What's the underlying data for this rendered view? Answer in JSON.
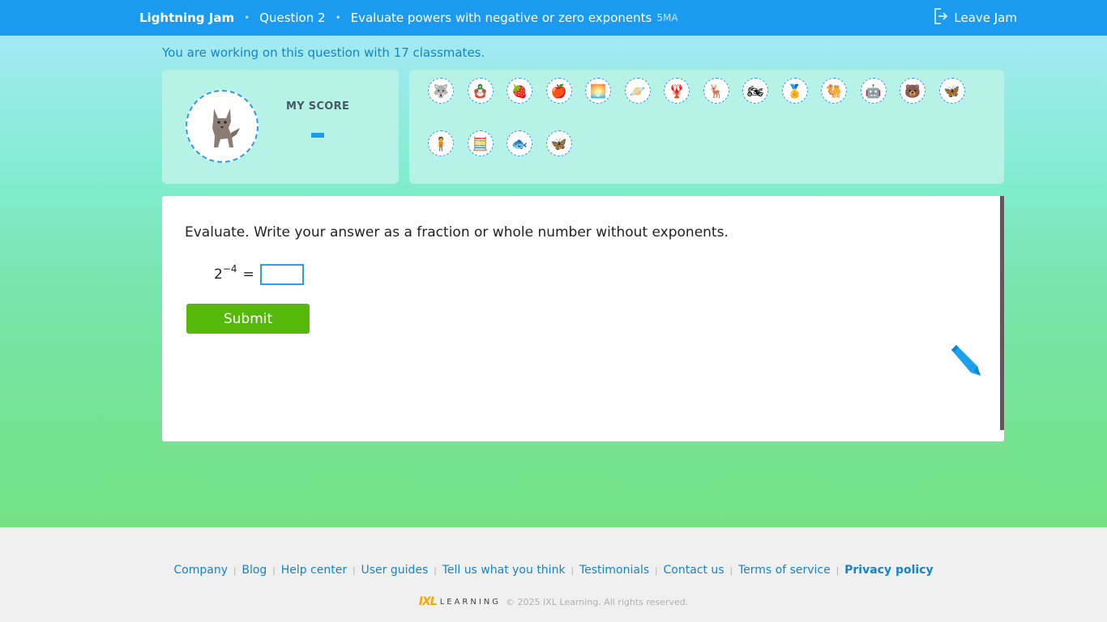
{
  "header": {
    "brand": "Lightning Jam",
    "question_label": "Question 2",
    "skill_title": "Evaluate powers with negative or zero exponents",
    "skill_code": "5MA",
    "leave_label": "Leave Jam",
    "separator": "•"
  },
  "classmates_text": "You are working on this question with 17 classmates.",
  "score": {
    "label": "MY SCORE",
    "value": "-"
  },
  "peers": [
    {
      "name": "peer-avatar-wolf",
      "emoji": "🐺"
    },
    {
      "name": "peer-avatar-nesting-doll",
      "emoji": "🪆"
    },
    {
      "name": "peer-avatar-strawberry",
      "emoji": "🍓"
    },
    {
      "name": "peer-avatar-apple",
      "emoji": "🍎"
    },
    {
      "name": "peer-avatar-sunset",
      "emoji": "🌅"
    },
    {
      "name": "peer-avatar-planet",
      "emoji": "🪐"
    },
    {
      "name": "peer-avatar-lobster",
      "emoji": "🦞"
    },
    {
      "name": "peer-avatar-deer",
      "emoji": "🦌"
    },
    {
      "name": "peer-avatar-motorcycle",
      "emoji": "🏍"
    },
    {
      "name": "peer-avatar-badge",
      "emoji": "🏅"
    },
    {
      "name": "peer-avatar-camel",
      "emoji": "🐫"
    },
    {
      "name": "peer-avatar-robot",
      "emoji": "🤖"
    },
    {
      "name": "peer-avatar-bear",
      "emoji": "🐻"
    },
    {
      "name": "peer-avatar-butterfly",
      "emoji": "🦋"
    },
    {
      "name": "peer-avatar-explorer",
      "emoji": "🧍"
    },
    {
      "name": "peer-avatar-calculator",
      "emoji": "🧮"
    },
    {
      "name": "peer-avatar-fish",
      "emoji": "🐟"
    },
    {
      "name": "peer-avatar-yellow-butterfly",
      "emoji": "🦋"
    }
  ],
  "question": {
    "prompt": "Evaluate. Write your answer as a fraction or whole number without exponents.",
    "base": "2",
    "exponent": "−4",
    "equals": "=",
    "answer_value": "",
    "submit_label": "Submit"
  },
  "footer": {
    "links": [
      {
        "label": "Company",
        "bold": false
      },
      {
        "label": "Blog",
        "bold": false
      },
      {
        "label": "Help center",
        "bold": false
      },
      {
        "label": "User guides",
        "bold": false
      },
      {
        "label": "Tell us what you think",
        "bold": false
      },
      {
        "label": "Testimonials",
        "bold": false
      },
      {
        "label": "Contact us",
        "bold": false
      },
      {
        "label": "Terms of service",
        "bold": false
      },
      {
        "label": "Privacy policy",
        "bold": true
      }
    ],
    "separator": "|",
    "logo_ixl": "IXL",
    "logo_learning": "LEARNING",
    "copyright": "© 2025 IXL Learning. All rights reserved."
  },
  "colors": {
    "header_bg": "#1a9bf0",
    "submit_bg": "#56b909",
    "accent": "#1a9bf0",
    "link": "#1584c8"
  }
}
